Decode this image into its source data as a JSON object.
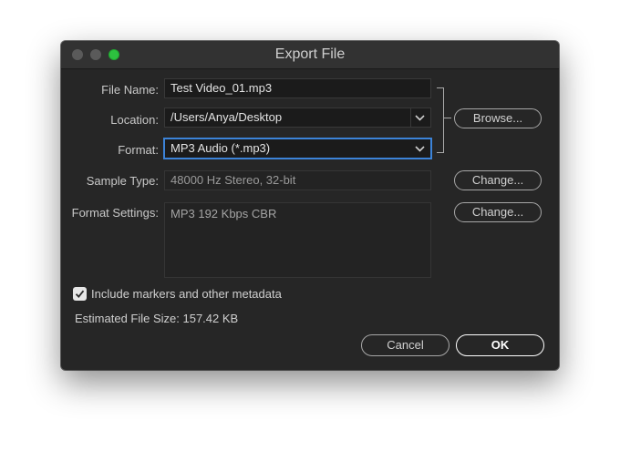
{
  "window": {
    "title": "Export File"
  },
  "form": {
    "file_name": {
      "label": "File Name:",
      "value": "Test Video_01.mp3"
    },
    "location": {
      "label": "Location:",
      "value": "/Users/Anya/Desktop",
      "icon": "chevron-down-icon"
    },
    "format": {
      "label": "Format:",
      "value": "MP3 Audio (*.mp3)",
      "icon": "chevron-down-icon"
    },
    "sample_type": {
      "label": "Sample Type:",
      "value": "48000 Hz Stereo, 32-bit"
    },
    "format_settings": {
      "label": "Format Settings:",
      "value": "MP3 192 Kbps CBR"
    }
  },
  "buttons": {
    "browse": "Browse...",
    "change_sample": "Change...",
    "change_format": "Change...",
    "cancel": "Cancel",
    "ok": "OK"
  },
  "metadata_checkbox": {
    "label": "Include markers and other metadata",
    "checked": true
  },
  "estimated_size": "Estimated File Size: 157.42 KB",
  "colors": {
    "background": "#262626",
    "titlebar": "#323232",
    "focus": "#3c83d8",
    "zoom_button": "#2dc13f"
  }
}
